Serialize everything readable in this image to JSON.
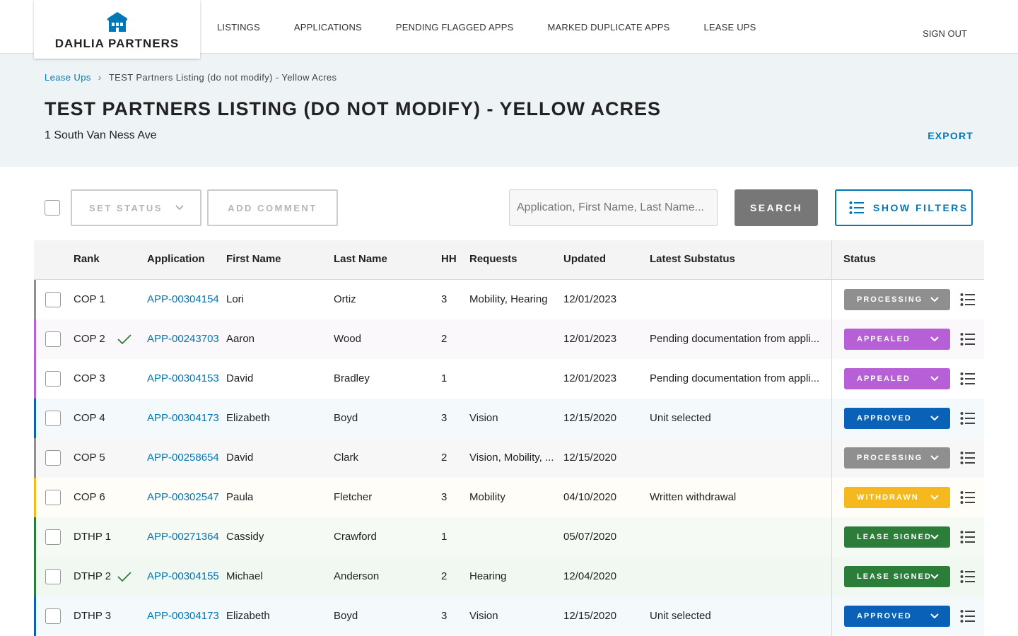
{
  "header": {
    "brand": "DAHLIA PARTNERS",
    "nav": [
      "LISTINGS",
      "APPLICATIONS",
      "PENDING FLAGGED APPS",
      "MARKED DUPLICATE APPS",
      "LEASE UPS"
    ],
    "sign_out": "SIGN OUT"
  },
  "banner": {
    "breadcrumb_link": "Lease Ups",
    "breadcrumb_current": "TEST Partners Listing (do not modify) - Yellow Acres",
    "title": "TEST PARTNERS LISTING (DO NOT MODIFY) - YELLOW ACRES",
    "address": "1 South Van Ness Ave",
    "export_label": "EXPORT"
  },
  "toolbar": {
    "set_status_label": "SET STATUS",
    "add_comment_label": "ADD COMMENT",
    "search_placeholder": "Application, First Name, Last Name...",
    "search_label": "SEARCH",
    "filters_label": "SHOW FILTERS"
  },
  "table": {
    "columns": {
      "rank": "Rank",
      "application": "Application",
      "first_name": "First Name",
      "last_name": "Last Name",
      "hh": "HH",
      "requests": "Requests",
      "updated": "Updated",
      "substatus": "Latest Substatus",
      "status": "Status"
    },
    "status_colors": {
      "PROCESSING": "#8f8f8f",
      "APPEALED": "#b65fd6",
      "APPROVED": "#0a62b8",
      "WITHDRAWN": "#f6b91d",
      "LEASE SIGNED": "#2d7d3a"
    },
    "rows": [
      {
        "rank": "COP 1",
        "verified": false,
        "application": "APP-00304154",
        "first_name": "Lori",
        "last_name": "Ortiz",
        "hh": "3",
        "requests": "Mobility, Hearing",
        "updated": "12/01/2023",
        "substatus": "",
        "status": "PROCESSING",
        "row_bg": "#ffffff",
        "accent": "#8f8f8f"
      },
      {
        "rank": "COP 2",
        "verified": true,
        "application": "APP-00243703",
        "first_name": "Aaron",
        "last_name": "Wood",
        "hh": "2",
        "requests": "",
        "updated": "12/01/2023",
        "substatus": "Pending documentation from appli...",
        "status": "APPEALED",
        "row_bg": "#fbf8fc",
        "accent": "#b65fd6"
      },
      {
        "rank": "COP 3",
        "verified": false,
        "application": "APP-00304153",
        "first_name": "David",
        "last_name": "Bradley",
        "hh": "1",
        "requests": "",
        "updated": "12/01/2023",
        "substatus": "Pending documentation from appli...",
        "status": "APPEALED",
        "row_bg": "#ffffff",
        "accent": "#b65fd6"
      },
      {
        "rank": "COP 4",
        "verified": false,
        "application": "APP-00304173",
        "first_name": "Elizabeth",
        "last_name": "Boyd",
        "hh": "3",
        "requests": "Vision",
        "updated": "12/15/2020",
        "substatus": "Unit selected",
        "status": "APPROVED",
        "row_bg": "#f4f9fc",
        "accent": "#0a62b8"
      },
      {
        "rank": "COP 5",
        "verified": false,
        "application": "APP-00258654",
        "first_name": "David",
        "last_name": "Clark",
        "hh": "2",
        "requests": "Vision, Mobility, ...",
        "updated": "12/15/2020",
        "substatus": "",
        "status": "PROCESSING",
        "row_bg": "#f7f7f7",
        "accent": "#8f8f8f"
      },
      {
        "rank": "COP 6",
        "verified": false,
        "application": "APP-00302547",
        "first_name": "Paula",
        "last_name": "Fletcher",
        "hh": "3",
        "requests": "Mobility",
        "updated": "04/10/2020",
        "substatus": "Written withdrawal",
        "status": "WITHDRAWN",
        "row_bg": "#fefdf8",
        "accent": "#f6b91d"
      },
      {
        "rank": "DTHP 1",
        "verified": false,
        "application": "APP-00271364",
        "first_name": "Cassidy",
        "last_name": "Crawford",
        "hh": "1",
        "requests": "",
        "updated": "05/07/2020",
        "substatus": "",
        "status": "LEASE SIGNED",
        "row_bg": "#f5faf5",
        "accent": "#2d7d3a"
      },
      {
        "rank": "DTHP 2",
        "verified": true,
        "application": "APP-00304155",
        "first_name": "Michael",
        "last_name": "Anderson",
        "hh": "2",
        "requests": "Hearing",
        "updated": "12/04/2020",
        "substatus": "",
        "status": "LEASE SIGNED",
        "row_bg": "#f1f8f2",
        "accent": "#2d7d3a"
      },
      {
        "rank": "DTHP 3",
        "verified": false,
        "application": "APP-00304173",
        "first_name": "Elizabeth",
        "last_name": "Boyd",
        "hh": "3",
        "requests": "Vision",
        "updated": "12/15/2020",
        "substatus": "Unit selected",
        "status": "APPROVED",
        "row_bg": "#f4f9fc",
        "accent": "#0a62b8"
      }
    ]
  }
}
